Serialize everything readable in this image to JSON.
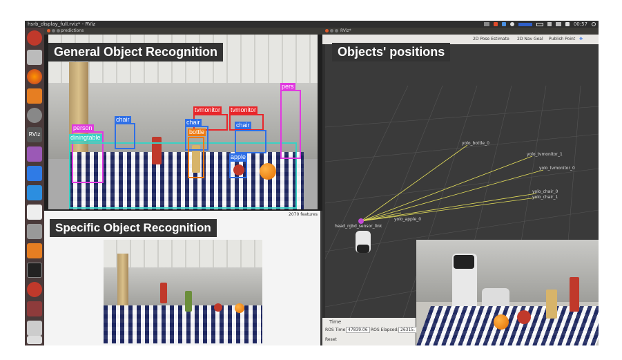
{
  "topbar": {
    "window_title": "hsrb_display_full.rviz* - RViz",
    "clock": "00:57"
  },
  "predictions_window": {
    "title": "predictions",
    "overlay_label": "General Object Recognition",
    "detections": [
      {
        "label": "person",
        "color": "#e03adf"
      },
      {
        "label": "diningtable",
        "color": "#3ad1c4"
      },
      {
        "label": "chair",
        "color": "#2f6fe6"
      },
      {
        "label": "tvmonitor",
        "color": "#e8262a"
      },
      {
        "label": "tvmonitor",
        "color": "#e8262a"
      },
      {
        "label": "chair",
        "color": "#2f6fe6"
      },
      {
        "label": "chair",
        "color": "#2f6fe6"
      },
      {
        "label": "bottle",
        "color": "#ef7a10"
      },
      {
        "label": "apple",
        "color": "#2f6fe6"
      },
      {
        "label": "pers",
        "color": "#e03adf"
      }
    ]
  },
  "specific_window": {
    "overlay_label": "Specific Object Recognition",
    "features_text": "2070 features"
  },
  "rviz": {
    "title": "RViz*",
    "overlay_label": "Objects' positions",
    "toolbar": {
      "pose_estimate": "2D Pose Estimate",
      "nav_goal": "2D Nav Goal",
      "publish_point": "Publish Point"
    },
    "frame_labels": [
      "yolo_bottle_0",
      "yolo_tvmonitor_1",
      "yolo_tvmonitor_0",
      "yolo_chair_0",
      "yolo_chair_1",
      "yolo_apple_0"
    ],
    "head_label": "head_rgbd_sensor_link",
    "time_panel": {
      "title": "Time",
      "ros_time_label": "ROS Time:",
      "ros_time_value": "47839.06",
      "ros_elapsed_label": "ROS Elapsed:",
      "ros_elapsed_value": "26315.",
      "reset_label": "Reset"
    }
  },
  "colors": {
    "label_bg": "#333333",
    "line_yellow": "#e6e05a",
    "desktop_bg": "#3b3b3b"
  }
}
